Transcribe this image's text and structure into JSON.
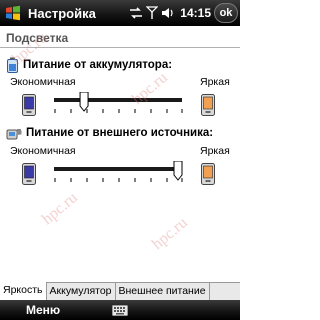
{
  "titlebar": {
    "title": "Настройка",
    "time": "14:15",
    "ok_label": "ok"
  },
  "page": {
    "section_title": "Подсветка"
  },
  "battery_group": {
    "title": "Питание от аккумулятора:",
    "min_label": "Экономичная",
    "max_label": "Яркая",
    "level_fraction": 0.23,
    "icon": "battery-icon"
  },
  "external_group": {
    "title": "Питание от внешнего источника:",
    "min_label": "Экономичная",
    "max_label": "Яркая",
    "level_fraction": 1.0,
    "icon": "power-plug-icon"
  },
  "tabs": [
    {
      "label": "Яркость",
      "active": true
    },
    {
      "label": "Аккумулятор",
      "active": false
    },
    {
      "label": "Внешнее питание",
      "active": false
    }
  ],
  "menubar": {
    "menu_label": "Меню",
    "keyboard_icon": "keyboard-icon"
  },
  "watermark": "hpc.ru",
  "colors": {
    "bar": "#1a1a1a",
    "accent": "#c0392b",
    "phone_screen_dim": "#3a3aa8",
    "phone_screen_bright": "#e8883a"
  }
}
